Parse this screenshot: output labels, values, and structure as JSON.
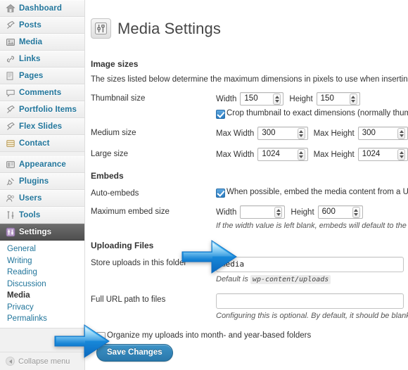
{
  "sidebar": {
    "items": [
      {
        "label": "Dashboard",
        "icon": "dashboard-icon"
      },
      {
        "label": "Posts",
        "icon": "pin-icon"
      },
      {
        "label": "Media",
        "icon": "media-icon"
      },
      {
        "label": "Links",
        "icon": "link-icon"
      },
      {
        "label": "Pages",
        "icon": "pages-icon"
      },
      {
        "label": "Comments",
        "icon": "comment-icon"
      },
      {
        "label": "Portfolio Items",
        "icon": "pin-icon"
      },
      {
        "label": "Flex Slides",
        "icon": "pin-icon"
      },
      {
        "label": "Contact",
        "icon": "contact-icon"
      },
      {
        "label": "Appearance",
        "icon": "appearance-icon"
      },
      {
        "label": "Plugins",
        "icon": "plug-icon"
      },
      {
        "label": "Users",
        "icon": "users-icon"
      },
      {
        "label": "Tools",
        "icon": "tools-icon"
      },
      {
        "label": "Settings",
        "icon": "settings-icon"
      }
    ],
    "submenu": [
      {
        "label": "General",
        "active": false
      },
      {
        "label": "Writing",
        "active": false
      },
      {
        "label": "Reading",
        "active": false
      },
      {
        "label": "Discussion",
        "active": false
      },
      {
        "label": "Media",
        "active": true
      },
      {
        "label": "Privacy",
        "active": false
      },
      {
        "label": "Permalinks",
        "active": false
      }
    ],
    "collapse_label": "Collapse menu"
  },
  "page": {
    "title": "Media Settings",
    "icon": "media-settings-sliders-icon"
  },
  "image_sizes": {
    "heading": "Image sizes",
    "description": "The sizes listed below determine the maximum dimensions in pixels to use when inserting an image into th",
    "thumbnail": {
      "label": "Thumbnail size",
      "width_label": "Width",
      "width_value": "150",
      "height_label": "Height",
      "height_value": "150",
      "crop_checked": true,
      "crop_label": "Crop thumbnail to exact dimensions (normally thumbnails are"
    },
    "medium": {
      "label": "Medium size",
      "width_label": "Max Width",
      "width_value": "300",
      "height_label": "Max Height",
      "height_value": "300"
    },
    "large": {
      "label": "Large size",
      "width_label": "Max Width",
      "width_value": "1024",
      "height_label": "Max Height",
      "height_value": "1024"
    }
  },
  "embeds": {
    "heading": "Embeds",
    "auto": {
      "label": "Auto-embeds",
      "checked": true,
      "checkbox_label": "When possible, embed the media content from a URL directl"
    },
    "max_size": {
      "label": "Maximum embed size",
      "width_label": "Width",
      "width_value": "",
      "height_label": "Height",
      "height_value": "600",
      "hint": "If the width value is left blank, embeds will default to the max wi"
    }
  },
  "uploading": {
    "heading": "Uploading Files",
    "folder": {
      "label": "Store uploads in this folder",
      "value": "media",
      "hint_prefix": "Default is",
      "hint_code": "wp-content/uploads"
    },
    "full_url": {
      "label": "Full URL path to files",
      "value": "",
      "hint": "Configuring this is optional. By default, it should be blank."
    },
    "organize": {
      "checked": false,
      "label": "Organize my uploads into month- and year-based folders"
    }
  },
  "actions": {
    "save_label": "Save Changes"
  },
  "annotations": {
    "arrow_folder": "blue-right-arrow-pointing-to-upload-folder-field",
    "arrow_organize": "blue-right-arrow-pointing-to-organize-checkbox",
    "accent_color": "#21759b",
    "arrow_color": "#1c9ae8"
  }
}
